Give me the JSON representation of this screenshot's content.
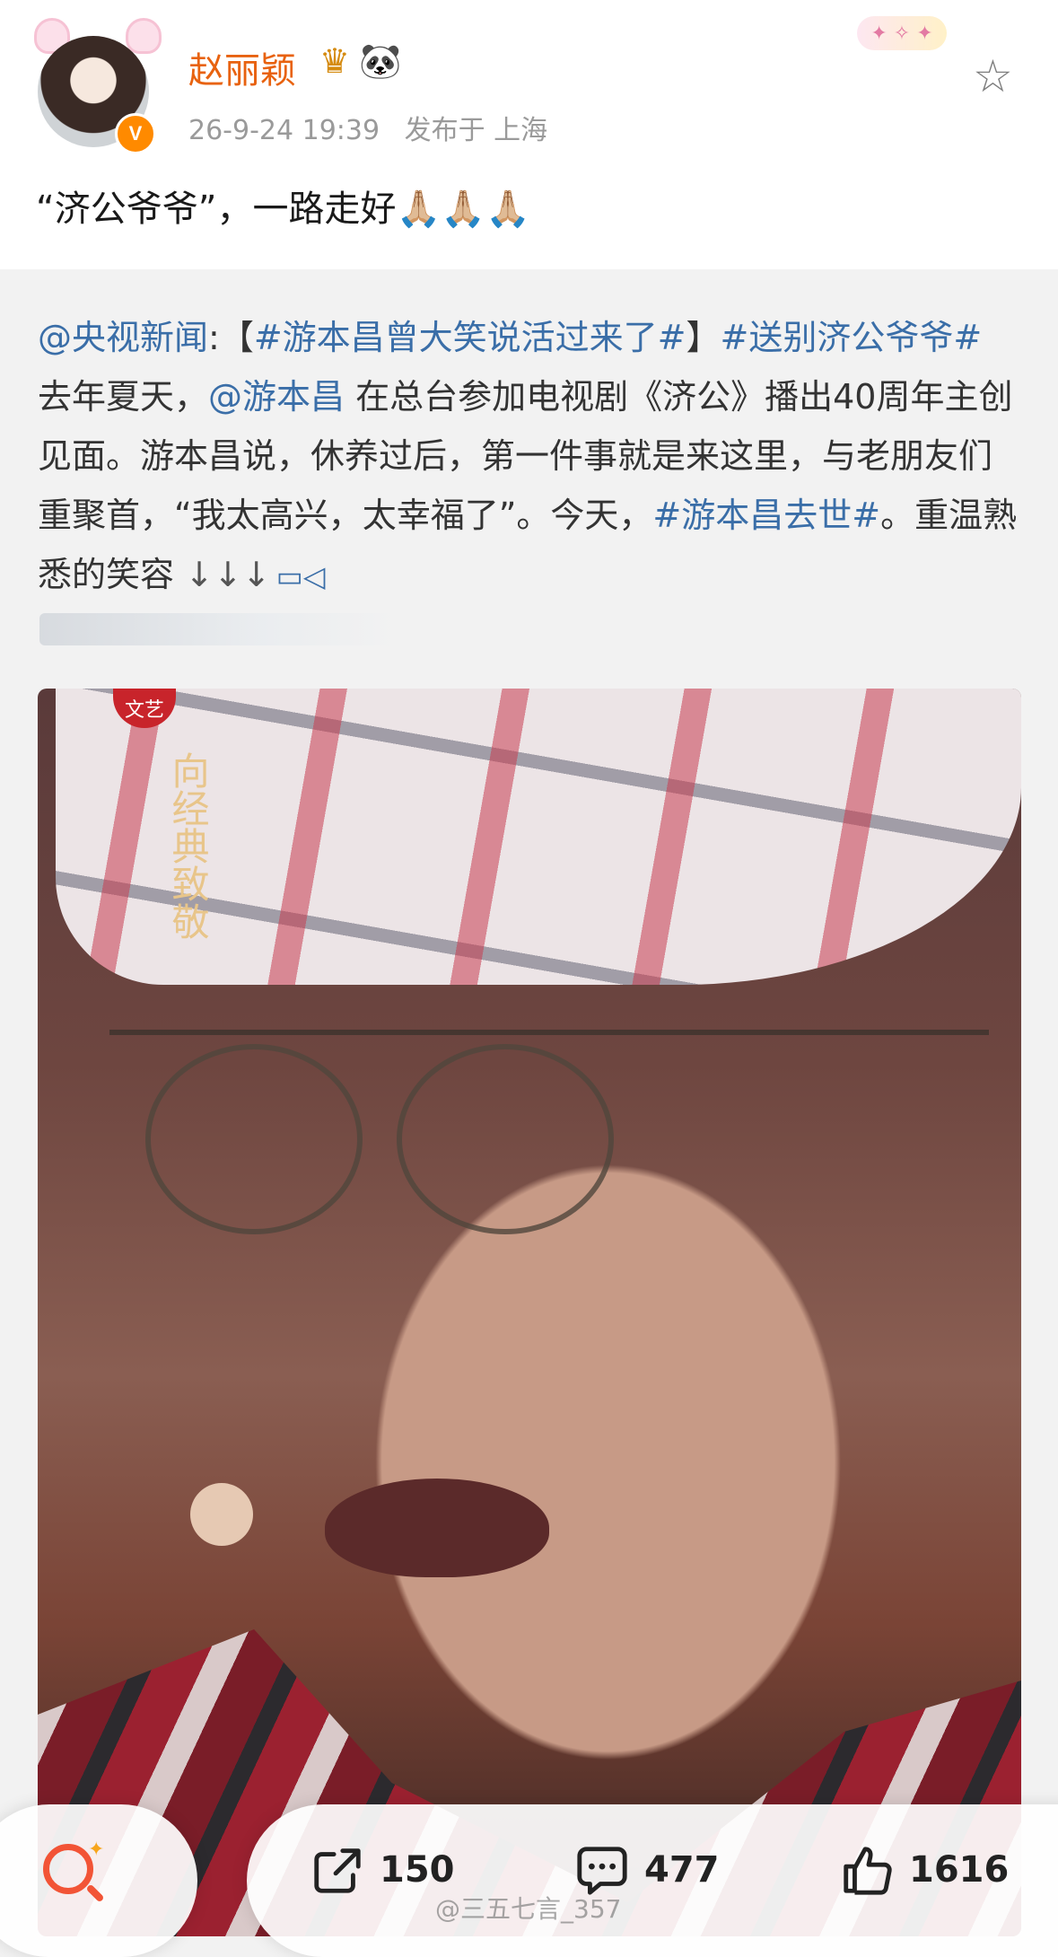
{
  "post": {
    "username": "赵丽颖",
    "badge_icons": [
      "crown-vip-icon",
      "panda-icon"
    ],
    "date": "26-9-24 19:39",
    "location_prefix": "发布于",
    "location": "上海",
    "text": "“济公爷爷”，一路走好🙏🏼🙏🏼🙏🏼"
  },
  "repost": {
    "mention_1": "@央视新闻",
    "colon": ":",
    "bracket_open": "【",
    "hashtag_1": "#游本昌曾大笑说活过来了#",
    "bracket_close": "】",
    "hashtag_2": "#送别济公爷爷#",
    "text_1": " 去年夏天，",
    "mention_2": "@游本昌",
    "text_2": " 在总台参加电视剧《济公》播出40周年主创见面。游本昌说，休养过后，第一件事就是来这里，与老朋友们重聚首，“我太高兴，太幸福了”。今天，",
    "hashtag_3": "#游本昌去世#",
    "text_3": "。重温熟悉的笑容",
    "arrows": "↓↓↓"
  },
  "photo": {
    "logo_text": "向经典致敬",
    "corner_logo": "文艺"
  },
  "actions": {
    "repost_count": "150",
    "comment_count": "477",
    "like_count": "1616"
  },
  "watermark": "@三五七言_357"
}
